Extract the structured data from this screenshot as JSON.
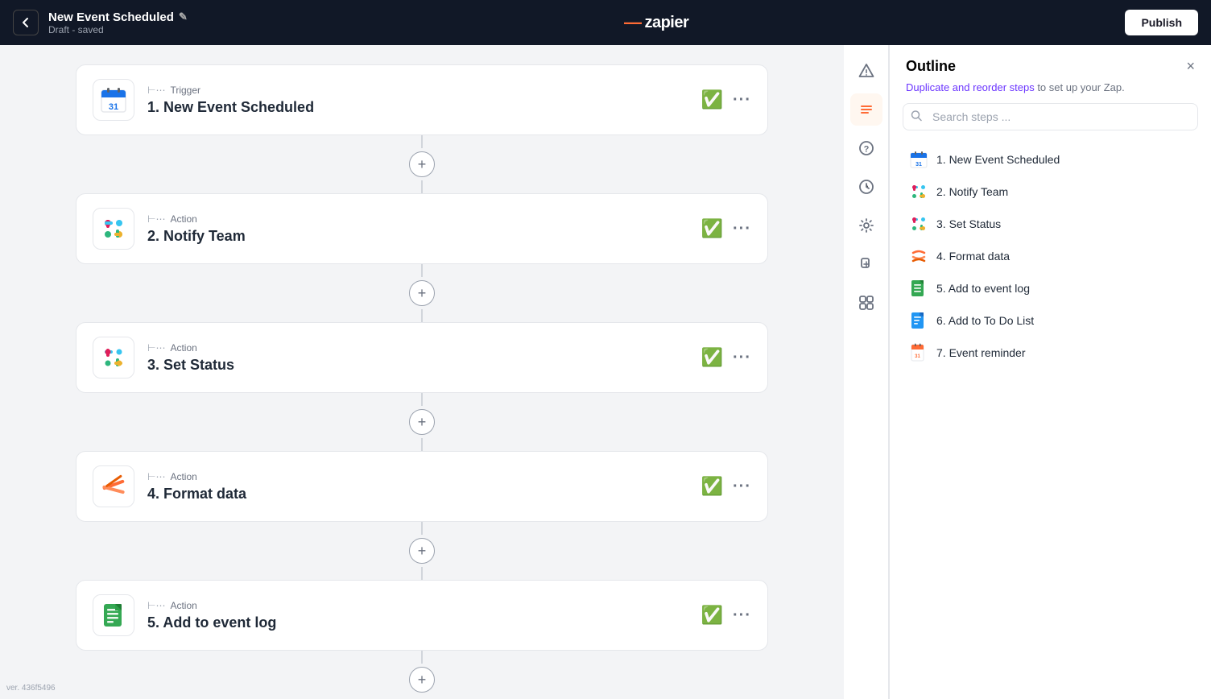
{
  "header": {
    "back_label": "←",
    "zap_name": "New Event Scheduled",
    "edit_icon": "✎",
    "status": "Draft - saved",
    "logo": "zapier",
    "logo_orange": "—",
    "publish_label": "Publish"
  },
  "sidebar": {
    "icons": [
      {
        "name": "warning-icon",
        "symbol": "⚠",
        "active": false
      },
      {
        "name": "list-icon",
        "symbol": "☰",
        "active": true
      },
      {
        "name": "help-icon",
        "symbol": "?",
        "active": false
      },
      {
        "name": "history-icon",
        "symbol": "⏱",
        "active": false
      },
      {
        "name": "settings-icon",
        "symbol": "⚙",
        "active": false
      },
      {
        "name": "bolt-icon",
        "symbol": "⚡",
        "active": false
      },
      {
        "name": "integration-icon",
        "symbol": "⚙",
        "active": false
      }
    ]
  },
  "canvas": {
    "steps": [
      {
        "id": "step-1",
        "type": "Trigger",
        "name": "1. New Event Scheduled",
        "icon_type": "google-cal",
        "checked": true
      },
      {
        "id": "step-2",
        "type": "Action",
        "name": "2. Notify Team",
        "icon_type": "slack",
        "checked": true
      },
      {
        "id": "step-3",
        "type": "Action",
        "name": "3. Set Status",
        "icon_type": "slack",
        "checked": true
      },
      {
        "id": "step-4",
        "type": "Action",
        "name": "4. Format data",
        "icon_type": "format",
        "checked": true
      },
      {
        "id": "step-5",
        "type": "Action",
        "name": "5. Add to event log",
        "icon_type": "sheets",
        "checked": true
      }
    ]
  },
  "outline": {
    "title": "Outline",
    "close_label": "×",
    "subtitle_text": " to set up your Zap.",
    "subtitle_link": "Duplicate and reorder steps",
    "search_placeholder": "Search steps ...",
    "steps": [
      {
        "name": "1. New Event Scheduled",
        "icon_type": "google-cal"
      },
      {
        "name": "2. Notify Team",
        "icon_type": "slack"
      },
      {
        "name": "3. Set Status",
        "icon_type": "slack"
      },
      {
        "name": "4. Format data",
        "icon_type": "format"
      },
      {
        "name": "5. Add to event log",
        "icon_type": "sheets"
      },
      {
        "name": "6. Add to To Do List",
        "icon_type": "todo"
      },
      {
        "name": "7. Event reminder",
        "icon_type": "event-reminder"
      }
    ]
  },
  "version": "ver. 436f5496"
}
